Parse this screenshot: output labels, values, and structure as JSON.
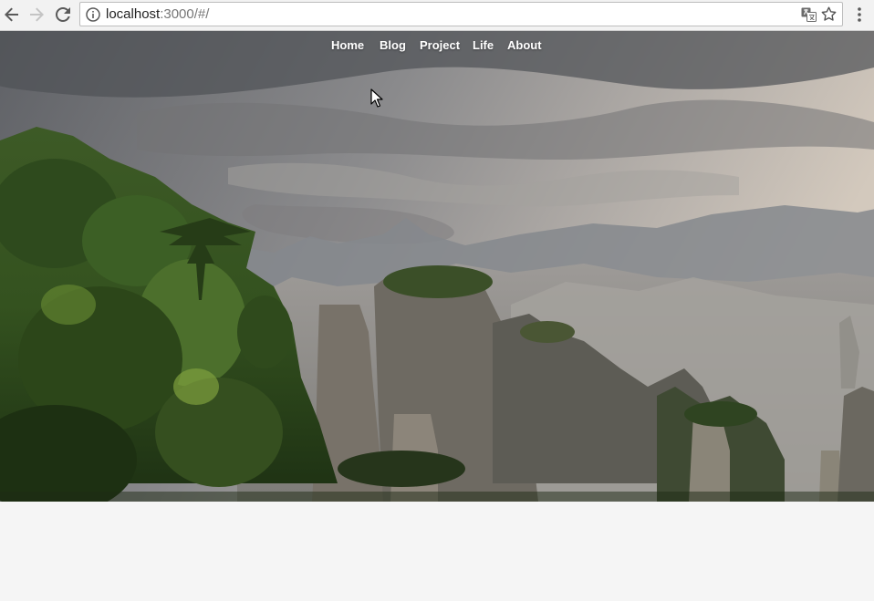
{
  "browser": {
    "url_host": "localhost",
    "url_rest": ":3000/#/",
    "icons": {
      "back": "arrow-left-icon",
      "forward": "arrow-right-icon",
      "reload": "reload-icon",
      "info": "info-circle-icon",
      "translate": "translate-icon",
      "bookmark": "star-icon",
      "menu": "vertical-dots-icon"
    }
  },
  "site": {
    "nav": {
      "home": "Home",
      "blog": "Blog",
      "project": "Project",
      "life": "Life",
      "about": "About"
    }
  },
  "colors": {
    "nav_text": "#ffffff",
    "page_background": "#f5f5f5",
    "chrome_background": "#f2f2f2"
  }
}
